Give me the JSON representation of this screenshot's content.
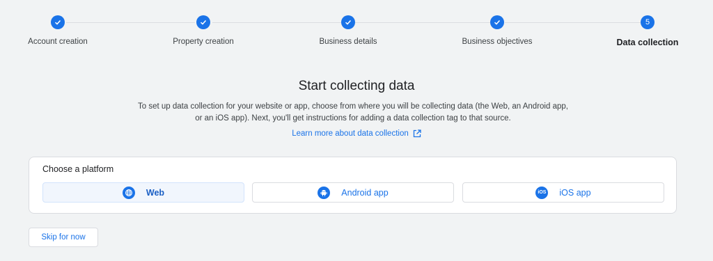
{
  "stepper": {
    "steps": [
      {
        "label": "Account creation",
        "state": "done",
        "icon": "check-icon"
      },
      {
        "label": "Property creation",
        "state": "done",
        "icon": "check-icon"
      },
      {
        "label": "Business details",
        "state": "done",
        "icon": "check-icon"
      },
      {
        "label": "Business objectives",
        "state": "done",
        "icon": "check-icon"
      },
      {
        "label": "Data collection",
        "state": "active",
        "number": "5"
      }
    ]
  },
  "main": {
    "title": "Start collecting data",
    "description": "To set up data collection for your website or app, choose from where you will be collecting data (the Web, an Android app, or an iOS app). Next, you'll get instructions for adding a data collection tag to that source.",
    "learn_more": "Learn more about data collection",
    "learn_more_icon": "external-link-icon"
  },
  "platform_card": {
    "title": "Choose a platform",
    "options": [
      {
        "label": "Web",
        "icon": "globe-icon",
        "selected": true
      },
      {
        "label": "Android app",
        "icon": "android-icon",
        "selected": false
      },
      {
        "label": "iOS app",
        "icon": "ios-icon",
        "icon_text": "iOS",
        "selected": false
      }
    ]
  },
  "skip_button": {
    "label": "Skip for now"
  },
  "colors": {
    "accent": "#1a73e8",
    "background": "#f1f3f4",
    "border": "#dadce0"
  }
}
